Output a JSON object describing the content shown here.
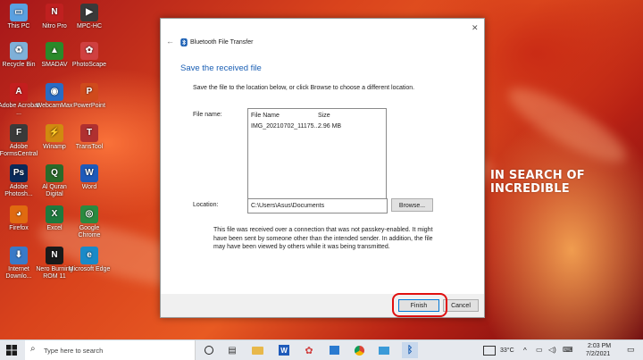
{
  "wallpaper": {
    "text": "IN SEARCH OF INCREDIBLE"
  },
  "desktop_icons": [
    {
      "label": "This PC",
      "color": "#5aa0e0",
      "glyph": "▭"
    },
    {
      "label": "Nitro Pro",
      "color": "#c02020",
      "glyph": "N"
    },
    {
      "label": "MPC-HC",
      "color": "#3a3a3a",
      "glyph": "▶"
    },
    {
      "label": "Recycle Bin",
      "color": "#7fb0d8",
      "glyph": "♻"
    },
    {
      "label": "SMADAV",
      "color": "#2a8a2a",
      "glyph": "▲"
    },
    {
      "label": "PhotoScape",
      "color": "#d04040",
      "glyph": "✿"
    },
    {
      "label": "Adobe Acrobat ...",
      "color": "#c41e1e",
      "glyph": "A"
    },
    {
      "label": "WebcamMax",
      "color": "#2a6cc4",
      "glyph": "◉"
    },
    {
      "label": "PowerPoint",
      "color": "#d04a1c",
      "glyph": "P"
    },
    {
      "label": "Adobe FormsCentral",
      "color": "#3a3a3a",
      "glyph": "F"
    },
    {
      "label": "Winamp",
      "color": "#d08a10",
      "glyph": "⚡"
    },
    {
      "label": "TransTool",
      "color": "#b03030",
      "glyph": "T"
    },
    {
      "label": "Adobe Photosh...",
      "color": "#0a2a5a",
      "glyph": "Ps"
    },
    {
      "label": "Al Quran Digital",
      "color": "#2a6a2a",
      "glyph": "Q"
    },
    {
      "label": "Word",
      "color": "#1e5aba",
      "glyph": "W"
    },
    {
      "label": "Firefox",
      "color": "#e06a10",
      "glyph": "◕"
    },
    {
      "label": "Excel",
      "color": "#1e7a3e",
      "glyph": "X"
    },
    {
      "label": "Google Chrome",
      "color": "#2a8a40",
      "glyph": "◎"
    },
    {
      "label": "Internet Downlo...",
      "color": "#3a7ac8",
      "glyph": "⬇"
    },
    {
      "label": "Nero Burning ROM 11",
      "color": "#1a1a1a",
      "glyph": "N"
    },
    {
      "label": "Microsoft Edge",
      "color": "#1a8ac8",
      "glyph": "e"
    }
  ],
  "dialog": {
    "window_title": "Bluetooth File Transfer",
    "heading": "Save the received file",
    "instruction": "Save the file to the location below, or click Browse to choose a different location.",
    "file_name_label": "File name:",
    "columns": [
      "File Name",
      "Size"
    ],
    "rows": [
      {
        "name": "IMG_20210702_11175...",
        "size": "2.96 MB"
      }
    ],
    "location_label": "Location:",
    "location_value": "C:\\Users\\Asus\\Documents",
    "browse_label": "Browse...",
    "warning": "This file was received over a connection that was not passkey-enabled. It might have been sent by someone other than the intended sender. In addition, the file may have been viewed by others while it was being transmitted.",
    "finish_label": "Finish",
    "cancel_label": "Cancel"
  },
  "taskbar": {
    "search_placeholder": "Type here to search",
    "temperature": "33°C",
    "time": "2:03 PM",
    "date": "7/2/2021"
  }
}
